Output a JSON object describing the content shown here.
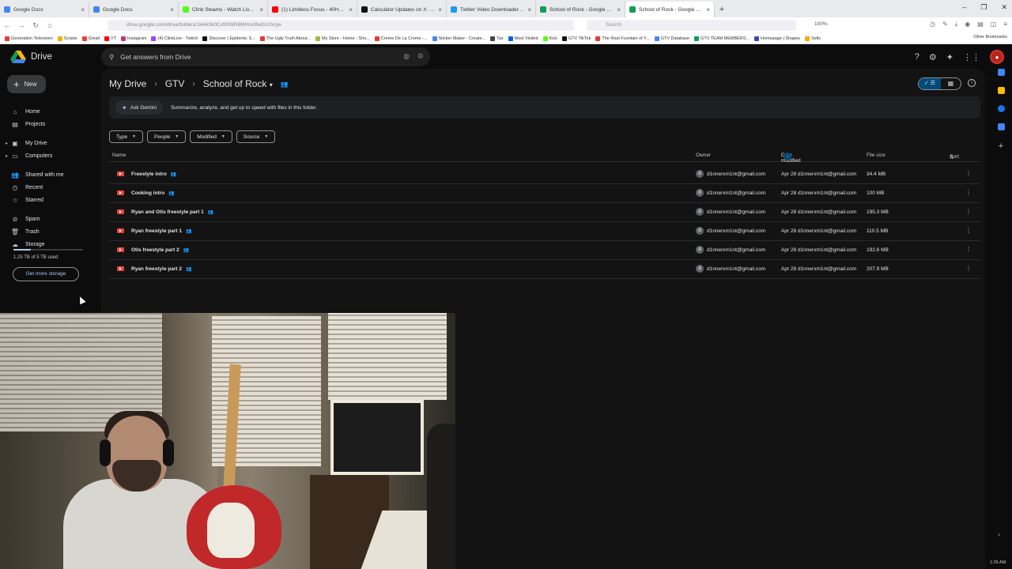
{
  "browser": {
    "tabs": [
      {
        "title": "Google Docs",
        "color": "#4285f4"
      },
      {
        "title": "Google Docs",
        "color": "#4285f4"
      },
      {
        "title": "Clink Steams - Watch Live on K",
        "color": "#53fc18"
      },
      {
        "title": "(1) Limitless Focus - 40Hz G",
        "color": "#ff0000"
      },
      {
        "title": "Calculator Updates on X: \"Clavic",
        "color": "#111111"
      },
      {
        "title": "Twitter Video Downloader - Do",
        "color": "#1d9bf0"
      },
      {
        "title": "School of Rock - Google Drive",
        "color": "#0f9d58"
      },
      {
        "title": "School of Rock - Google Drive",
        "color": "#0f9d58"
      }
    ],
    "close_glyph": "×",
    "new_tab_glyph": "+",
    "window_controls": [
      "–",
      "❐",
      "✕"
    ],
    "url": "drive.google.com/drive/folders/1kli4i0k0Cv9SWR8MHrx3fwGU2vcjw",
    "search_placeholder": "Search",
    "zoom": "100%",
    "bookmarks": [
      {
        "label": "Generation Television",
        "color": "#e53935"
      },
      {
        "label": "Scripts",
        "color": "#f9ab00"
      },
      {
        "label": "Gmail",
        "color": "#ea4335"
      },
      {
        "label": "YT",
        "color": "#ff0000"
      },
      {
        "label": "Instagram",
        "color": "#c13584"
      },
      {
        "label": "(4) ClinkLive - Twitch",
        "color": "#9146ff"
      },
      {
        "label": "Discover | Epidemic S...",
        "color": "#111111"
      },
      {
        "label": "The Ugly Truth About...",
        "color": "#e53935"
      },
      {
        "label": "My Store - Home - Sho...",
        "color": "#95bf47"
      },
      {
        "label": "Creme De La Creme -...",
        "color": "#e53935"
      },
      {
        "label": "Sticker Maker - Create...",
        "color": "#4285f4"
      },
      {
        "label": "Tax",
        "color": "#444444"
      },
      {
        "label": "Most Visited",
        "color": "#0060df"
      },
      {
        "label": "Kick",
        "color": "#53fc18"
      },
      {
        "label": "GTV TikTok",
        "color": "#111111"
      },
      {
        "label": "The Real Fountain of Y...",
        "color": "#e53935"
      },
      {
        "label": "GTV Database",
        "color": "#4285f4"
      },
      {
        "label": "GTV TEAM MEMBERS...",
        "color": "#0f9d58"
      },
      {
        "label": "Homepage | Shapes",
        "color": "#3949ab"
      },
      {
        "label": "Sells",
        "color": "#f9ab00"
      }
    ],
    "other_bookmarks": "Other Bookmarks"
  },
  "drive": {
    "logo_text": "Drive",
    "search_placeholder": "Get answers from Drive",
    "new_label": "New",
    "nav": [
      {
        "label": "Home",
        "icon": "home-icon",
        "glyph": "⌂",
        "expandable": false
      },
      {
        "label": "Projects",
        "icon": "projects-icon",
        "glyph": "▤",
        "expandable": false
      },
      {
        "label": "My Drive",
        "icon": "my-drive-icon",
        "glyph": "▣",
        "expandable": true
      },
      {
        "label": "Computers",
        "icon": "computers-icon",
        "glyph": "▭",
        "expandable": true
      },
      {
        "label": "Shared with me",
        "icon": "shared-icon",
        "glyph": "👥",
        "expandable": false
      },
      {
        "label": "Recent",
        "icon": "recent-icon",
        "glyph": "◷",
        "expandable": false
      },
      {
        "label": "Starred",
        "icon": "starred-icon",
        "glyph": "☆",
        "expandable": false
      },
      {
        "label": "Spam",
        "icon": "spam-icon",
        "glyph": "⊘",
        "expandable": false
      },
      {
        "label": "Trash",
        "icon": "trash-icon",
        "glyph": "🗑",
        "expandable": false
      },
      {
        "label": "Storage",
        "icon": "storage-icon",
        "glyph": "☁",
        "expandable": false
      }
    ],
    "storage_text": "1.25 TB of 5 TB used",
    "storage_fraction": 0.25,
    "get_storage_label": "Get more storage",
    "breadcrumb": [
      "My Drive",
      "GTV",
      "School of Rock"
    ],
    "gemini": {
      "button_label": "Ask Gemini",
      "prompt": "Summarize, analyze, and get up to speed with files in this folder."
    },
    "filters": [
      "Type",
      "People",
      "Modified",
      "Source"
    ],
    "columns": {
      "name": "Name",
      "owner": "Owner",
      "modified": "Date modified",
      "size": "File size",
      "sort": "Sort"
    },
    "files": [
      {
        "name": "Freestyle intro",
        "owner_initial": "d",
        "owner": "d1nnerxm1nt@gmail.com",
        "modified": "Apr 28 d1nnerxm1nt@gmail.com",
        "size": "34.4 MB"
      },
      {
        "name": "Cooking intro",
        "owner_initial": "d",
        "owner": "d1nnerxm1nt@gmail.com",
        "modified": "Apr 28 d1nnerxm1nt@gmail.com",
        "size": "100 MB"
      },
      {
        "name": "Ryan and Otis freestyle part 1",
        "owner_initial": "d",
        "owner": "d1nnerxm1nt@gmail.com",
        "modified": "Apr 28 d1nnerxm1nt@gmail.com",
        "size": "195.3 MB"
      },
      {
        "name": "Ryan freestyle part 1",
        "owner_initial": "d",
        "owner": "d1nnerxm1nt@gmail.com",
        "modified": "Apr 28 d1nnerxm1nt@gmail.com",
        "size": "110.5 MB"
      },
      {
        "name": "Otis freestyle part 2",
        "owner_initial": "d",
        "owner": "d1nnerxm1nt@gmail.com",
        "modified": "Apr 28 d1nnerxm1nt@gmail.com",
        "size": "192.6 MB"
      },
      {
        "name": "Ryan freestyle part 2",
        "owner_initial": "d",
        "owner": "d1nnerxm1nt@gmail.com",
        "modified": "Apr 28 d1nnerxm1nt@gmail.com",
        "size": "207.9 MB"
      }
    ],
    "taskbar_time": "1:26 AM"
  }
}
